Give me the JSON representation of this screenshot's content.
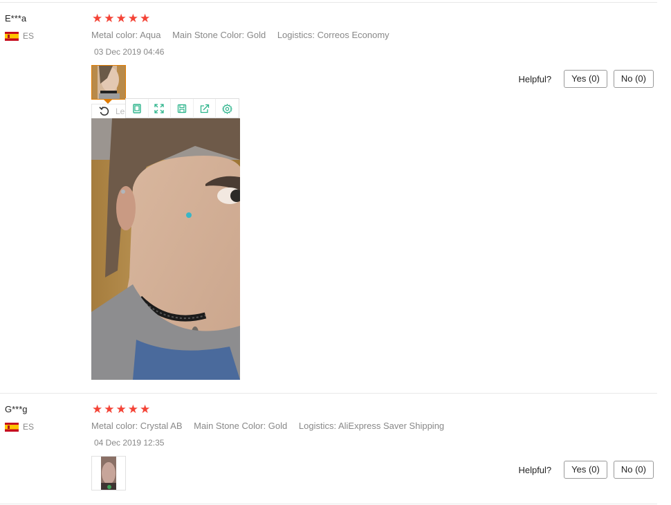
{
  "reviews": [
    {
      "user": "E***a",
      "country": "ES",
      "rating": 5,
      "attributes": [
        "Metal color: Aqua",
        "Main Stone Color: Gold",
        "Logistics: Correos Economy"
      ],
      "date": "03 Dec 2019 04:46",
      "helpful_label": "Helpful?",
      "yes_label": "Yes (0)",
      "no_label": "No (0)"
    },
    {
      "user": "G***g",
      "country": "ES",
      "rating": 5,
      "attributes": [
        "Metal color: Crystal AB",
        "Main Stone Color: Gold",
        "Logistics: AliExpress Saver Shipping"
      ],
      "date": "04 Dec 2019 12:35",
      "helpful_label": "Helpful?",
      "yes_label": "Yes (0)",
      "no_label": "No (0)"
    }
  ],
  "viewer": {
    "rotate_label": "Le",
    "tools": [
      "single-page-icon",
      "fullscreen-icon",
      "save-icon",
      "share-icon",
      "settings-icon"
    ],
    "accent": "#2bb38a"
  },
  "colors": {
    "star": "#f44336",
    "thumb_selected": "#e07b00"
  }
}
